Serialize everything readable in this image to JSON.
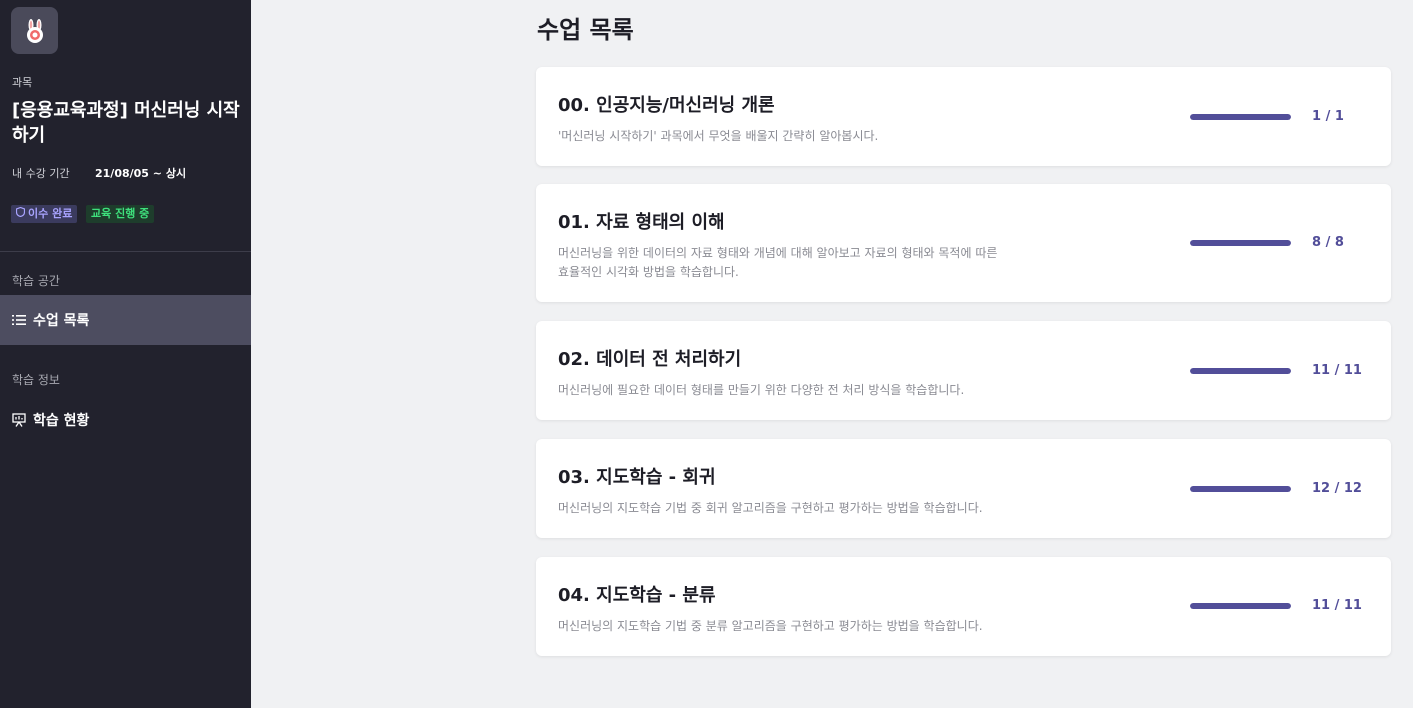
{
  "sidebar": {
    "logo_icon": "rabbit-logo-icon",
    "course_label": "과목",
    "course_title": "[응용교육과정] 머신러닝 시작하기",
    "period_label": "내 수강 기간",
    "period_value": "21/08/05 ~ 상시",
    "badges": {
      "complete": "이수 완료",
      "in_progress": "교육 진행 중"
    },
    "sections": [
      {
        "label": "학습 공간",
        "items": [
          {
            "label": "수업 목록",
            "icon": "list-icon",
            "active": true
          }
        ]
      },
      {
        "label": "학습 정보",
        "items": [
          {
            "label": "학습 현황",
            "icon": "presentation-icon",
            "active": false
          }
        ]
      }
    ]
  },
  "main": {
    "title": "수업 목록",
    "lessons": [
      {
        "title": "00. 인공지능/머신러닝 개론",
        "description": "'머신러닝 시작하기' 과목에서 무엇을 배울지 간략히 알아봅시다.",
        "done": 1,
        "total": 1,
        "count": "1 / 1"
      },
      {
        "title": "01. 자료 형태의 이해",
        "description": "머신러닝을 위한 데이터의 자료 형태와 개념에 대해 알아보고 자료의 형태와 목적에 따른 효율적인 시각화 방법을 학습합니다.",
        "done": 8,
        "total": 8,
        "count": "8 / 8"
      },
      {
        "title": "02. 데이터 전 처리하기",
        "description": "머신러닝에 필요한 데이터 형태를 만들기 위한 다양한 전 처리 방식을 학습합니다.",
        "done": 11,
        "total": 11,
        "count": "11 / 11"
      },
      {
        "title": "03. 지도학습 - 회귀",
        "description": "머신러닝의 지도학습 기법 중 회귀 알고리즘을 구현하고 평가하는 방법을 학습합니다.",
        "done": 12,
        "total": 12,
        "count": "12 / 12"
      },
      {
        "title": "04. 지도학습 - 분류",
        "description": "머신러닝의 지도학습 기법 중 분류 알고리즘을 구현하고 평가하는 방법을 학습합니다.",
        "done": 11,
        "total": 11,
        "count": "11 / 11"
      }
    ]
  },
  "colors": {
    "sidebar_bg": "#22222d",
    "accent": "#524e99",
    "page_bg": "#f0f1f3"
  }
}
